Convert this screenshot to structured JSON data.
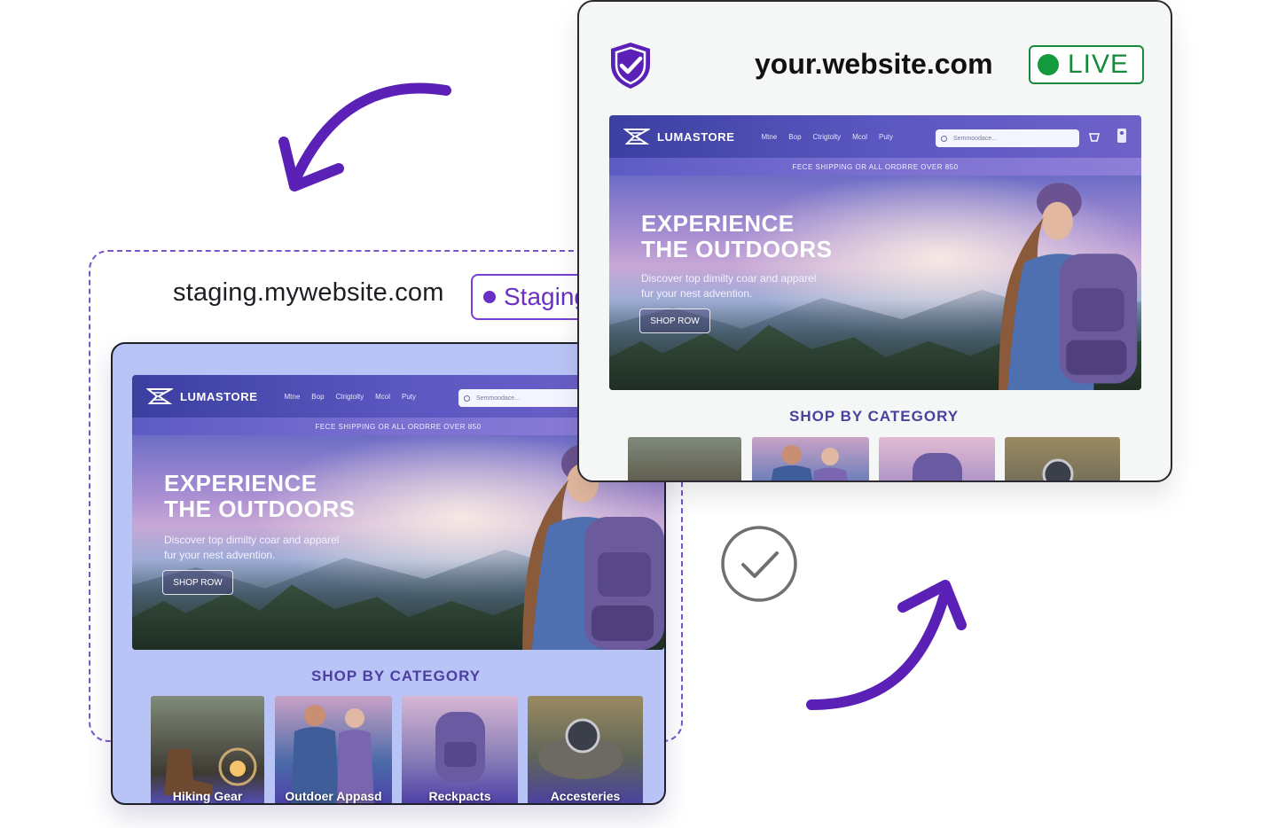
{
  "staging": {
    "url": "staging.mywebsite.com",
    "badge_label": "Staging"
  },
  "live": {
    "url": "your.website.com",
    "badge_label": "LIVE"
  },
  "site": {
    "brand": "LUMASTORE",
    "nav": [
      "Mtne",
      "Bop",
      "Ctrigtolty",
      "Mcol",
      "Puty"
    ],
    "search_placeholder": "Semmoodace...",
    "promo": "FECE SHIPPING OR ALL ORDRRE OVER 850",
    "hero_title_line1": "EXPERIENCE",
    "hero_title_line2": "THE OUTDOORS",
    "hero_sub_line1": "Discover top dimilty coar and apparel",
    "hero_sub_line2": "fur your nest advention.",
    "hero_button": "SHOP ROW",
    "category_heading": "SHOP BY CATEGORY",
    "categories": [
      "Hiking Gear",
      "Outdoer Appasd",
      "Reckpacts",
      "Accesteries"
    ]
  },
  "colors": {
    "accent_purple": "#5b21b6",
    "live_green": "#178a3a",
    "staging_bg": "#b9c4f6"
  },
  "icons": [
    "shield-check-icon",
    "checkmark-circle-icon",
    "arrow-to-staging-icon",
    "arrow-to-live-icon",
    "search-icon",
    "logo-icon"
  ]
}
